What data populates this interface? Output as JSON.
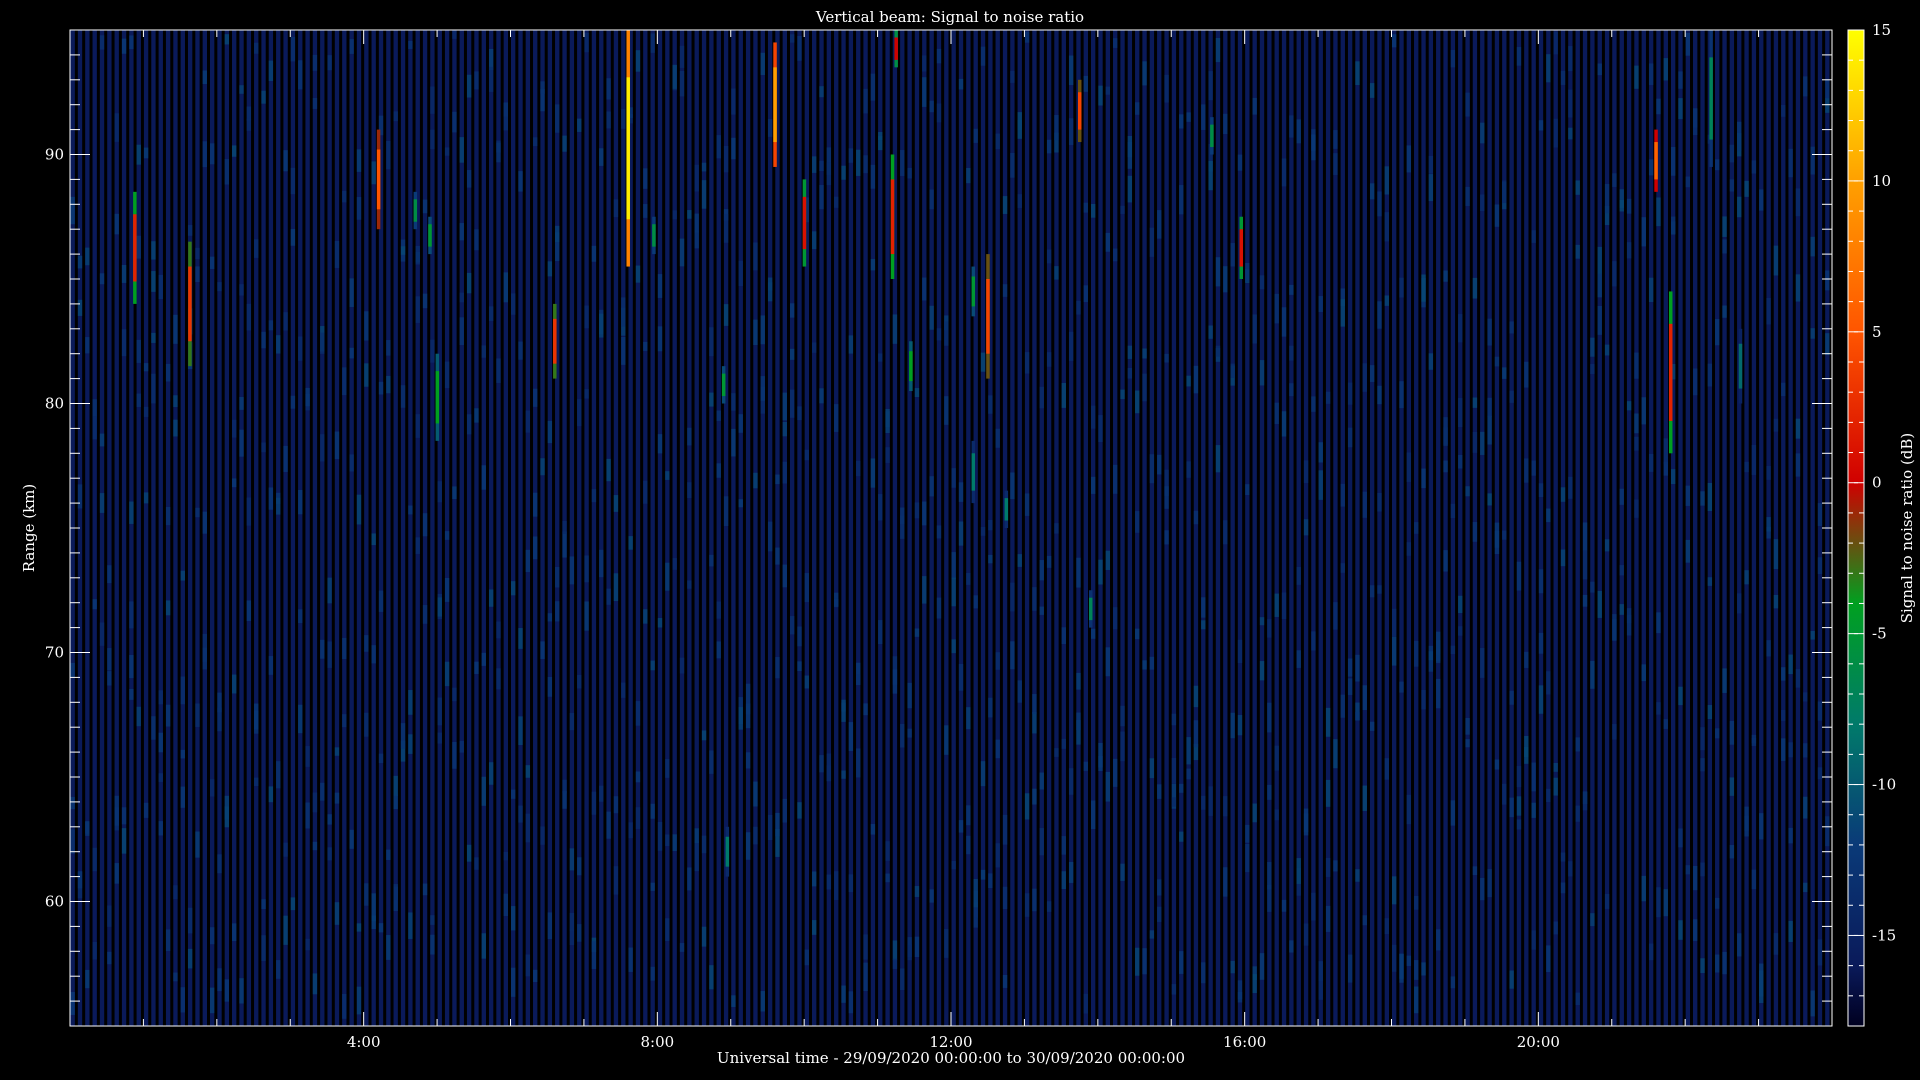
{
  "chart_data": {
    "type": "heatmap",
    "title": "Vertical beam: Signal to noise ratio",
    "xlabel": "Universal time - 29/09/2020 00:00:00 to 30/09/2020 00:00:00",
    "ylabel": "Range (km)",
    "colorbar_label": "Signal to noise ratio (dB)",
    "x_range_hours": [
      0,
      24
    ],
    "y_range_km": [
      55,
      95
    ],
    "x_tick_values_hours": [
      4,
      8,
      12,
      16,
      20
    ],
    "x_tick_labels": [
      "4:00",
      "8:00",
      "12:00",
      "16:00",
      "20:00"
    ],
    "y_tick_values_km": [
      60,
      70,
      80,
      90
    ],
    "y_tick_labels": [
      "60",
      "70",
      "80",
      "90"
    ],
    "colorbar_range_db": [
      -18,
      15
    ],
    "colorbar_tick_values": [
      15,
      10,
      5,
      0,
      -5,
      -10,
      -15
    ],
    "colorbar_tick_labels": [
      "15",
      "10",
      "5",
      "0",
      "-5",
      "-10",
      "-15"
    ],
    "background_level_db": -16,
    "grid": false,
    "colormap": [
      {
        "v": -18,
        "c": "#000020"
      },
      {
        "v": -16,
        "c": "#0a1a5a"
      },
      {
        "v": -12,
        "c": "#0a3a78"
      },
      {
        "v": -8,
        "c": "#007a6a"
      },
      {
        "v": -4,
        "c": "#00a020"
      },
      {
        "v": 0,
        "c": "#d00000"
      },
      {
        "v": 5,
        "c": "#ff5500"
      },
      {
        "v": 10,
        "c": "#ffa000"
      },
      {
        "v": 15,
        "c": "#ffff00"
      }
    ],
    "events": [
      {
        "t": 0.88,
        "r0": 84,
        "r1": 88.5,
        "snr": 2
      },
      {
        "t": 1.63,
        "r0": 81.5,
        "r1": 86.5,
        "snr": 3
      },
      {
        "t": 4.2,
        "r0": 87,
        "r1": 91,
        "snr": 5
      },
      {
        "t": 4.7,
        "r0": 87,
        "r1": 88.5,
        "snr": -6
      },
      {
        "t": 4.9,
        "r0": 86,
        "r1": 87.5,
        "snr": -5
      },
      {
        "t": 5.0,
        "r0": 78.5,
        "r1": 82,
        "snr": -4
      },
      {
        "t": 6.6,
        "r0": 81,
        "r1": 84,
        "snr": 3
      },
      {
        "t": 7.6,
        "r0": 85.5,
        "r1": 95,
        "snr": 14
      },
      {
        "t": 7.95,
        "r0": 86,
        "r1": 87.5,
        "snr": -6
      },
      {
        "t": 8.9,
        "r0": 80,
        "r1": 81.5,
        "snr": -5
      },
      {
        "t": 8.95,
        "r0": 61,
        "r1": 63,
        "snr": -8
      },
      {
        "t": 9.6,
        "r0": 89.5,
        "r1": 94.5,
        "snr": 10
      },
      {
        "t": 10.0,
        "r0": 85.5,
        "r1": 89,
        "snr": 1
      },
      {
        "t": 11.2,
        "r0": 85,
        "r1": 90,
        "snr": 2
      },
      {
        "t": 11.25,
        "r0": 93.5,
        "r1": 95,
        "snr": 0
      },
      {
        "t": 11.45,
        "r0": 80.5,
        "r1": 82.5,
        "snr": -4
      },
      {
        "t": 12.3,
        "r0": 83.5,
        "r1": 85.5,
        "snr": -5
      },
      {
        "t": 12.3,
        "r0": 76,
        "r1": 78.5,
        "snr": -8
      },
      {
        "t": 12.5,
        "r0": 81,
        "r1": 86,
        "snr": 4
      },
      {
        "t": 12.75,
        "r0": 75,
        "r1": 76.5,
        "snr": -8
      },
      {
        "t": 13.75,
        "r0": 90.5,
        "r1": 93,
        "snr": 4
      },
      {
        "t": 13.9,
        "r0": 71,
        "r1": 72.5,
        "snr": -7
      },
      {
        "t": 15.55,
        "r0": 90,
        "r1": 91.5,
        "snr": -6
      },
      {
        "t": 15.95,
        "r0": 85,
        "r1": 87.5,
        "snr": 1
      },
      {
        "t": 21.6,
        "r0": 88.5,
        "r1": 91,
        "snr": 6
      },
      {
        "t": 21.8,
        "r0": 78,
        "r1": 84.5,
        "snr": 2
      },
      {
        "t": 22.35,
        "r0": 89.5,
        "r1": 95,
        "snr": -7
      },
      {
        "t": 22.75,
        "r0": 80,
        "r1": 83,
        "snr": -9
      }
    ]
  }
}
